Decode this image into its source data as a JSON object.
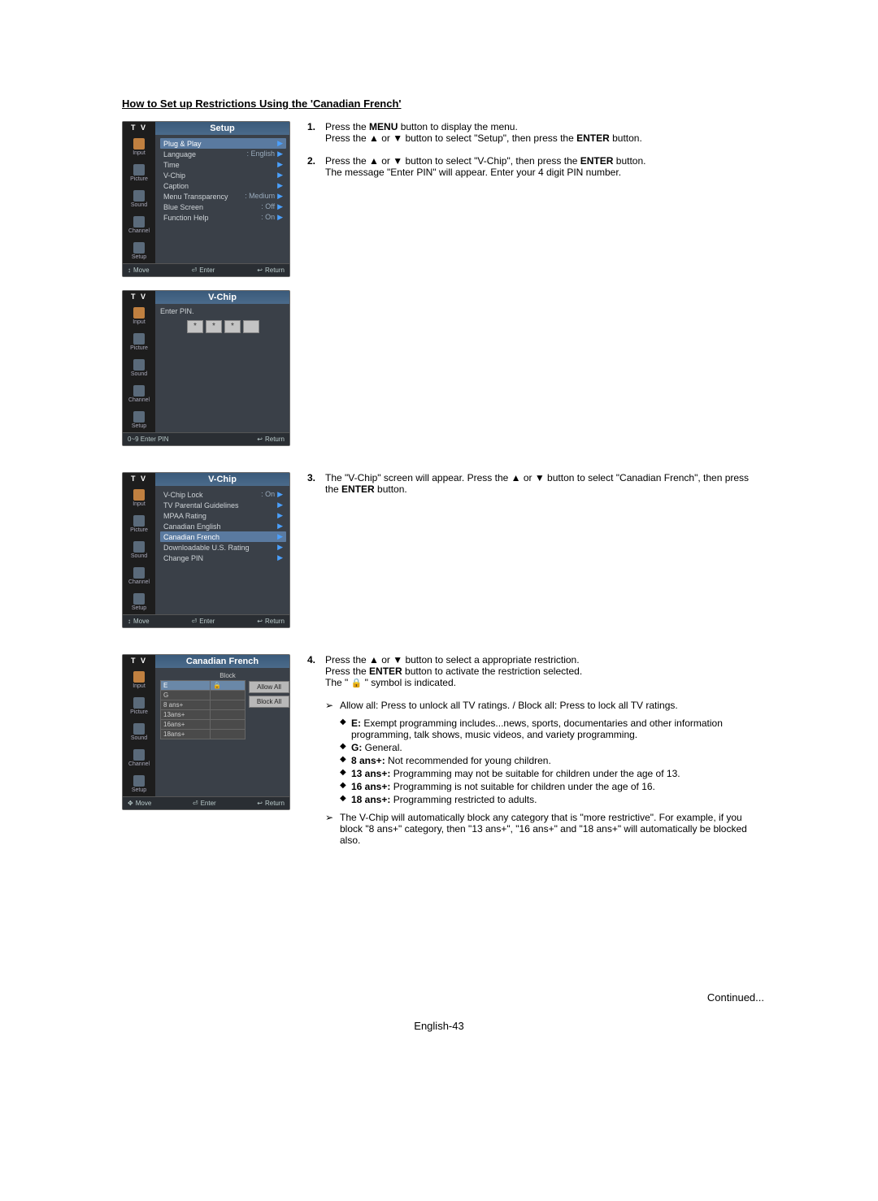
{
  "title": "How to Set up Restrictions Using the 'Canadian French'",
  "sidebar_labels": [
    "Input",
    "Picture",
    "Sound",
    "Channel",
    "Setup"
  ],
  "tv_label": "T V",
  "menu1": {
    "title": "Setup",
    "items": [
      {
        "label": "Plug & Play",
        "val": "",
        "sel": true
      },
      {
        "label": "Language",
        "val": ": English"
      },
      {
        "label": "Time",
        "val": ""
      },
      {
        "label": "V-Chip",
        "val": ""
      },
      {
        "label": "Caption",
        "val": ""
      },
      {
        "label": "Menu Transparency",
        "val": ": Medium"
      },
      {
        "label": "Blue Screen",
        "val": ": Off"
      },
      {
        "label": "Function Help",
        "val": ": On"
      }
    ],
    "footer": {
      "a": "Move",
      "b": "Enter",
      "c": "Return"
    },
    "footer_icon_a": "↕"
  },
  "menu2": {
    "title": "V-Chip",
    "prompt": "Enter PIN.",
    "stars": [
      "*",
      "*",
      "*",
      ""
    ],
    "footer": {
      "a": "0~9  Enter PIN",
      "c": "Return"
    }
  },
  "menu3": {
    "title": "V-Chip",
    "items": [
      {
        "label": "V-Chip Lock",
        "val": ": On"
      },
      {
        "label": "TV Parental Guidelines",
        "val": ""
      },
      {
        "label": "MPAA Rating",
        "val": ""
      },
      {
        "label": "Canadian English",
        "val": ""
      },
      {
        "label": "Canadian French",
        "val": "",
        "sel": true
      },
      {
        "label": "Downloadable U.S. Rating",
        "val": ""
      },
      {
        "label": "Change PIN",
        "val": ""
      }
    ],
    "footer": {
      "a": "Move",
      "b": "Enter",
      "c": "Return"
    },
    "footer_icon_a": "↕"
  },
  "menu4": {
    "title": "Canadian French",
    "col": "Block",
    "rows": [
      {
        "r": "E",
        "sel": true,
        "lock": true
      },
      {
        "r": "G"
      },
      {
        "r": "8  ans+"
      },
      {
        "r": "13ans+"
      },
      {
        "r": "16ans+"
      },
      {
        "r": "18ans+"
      }
    ],
    "btn_allow": "Allow All",
    "btn_block": "Block All",
    "footer": {
      "a": "Move",
      "b": "Enter",
      "c": "Return"
    },
    "footer_icon_a": "✥"
  },
  "steps": {
    "s1a": "Press the ",
    "s1b": "MENU",
    "s1c": " button to display the menu.",
    "s1d": "Press the ▲ or ▼ button to select \"Setup\", then press the ",
    "s1e": "ENTER",
    "s1f": " button.",
    "s2a": "Press the ▲ or ▼ button to select \"V-Chip\", then press the ",
    "s2b": "ENTER",
    "s2c": " button.",
    "s2d": "The message \"Enter PIN\" will appear. Enter your 4 digit PIN number.",
    "s3a": "The \"V-Chip\" screen will appear. Press the ▲ or ▼ button to select \"Canadian French\", then press the ",
    "s3b": "ENTER",
    "s3c": " button.",
    "s4a": "Press the ▲ or ▼ button to select a appropriate restriction.",
    "s4b": "Press the ",
    "s4c": "ENTER",
    "s4d": " button to activate the restriction selected.",
    "s4e": "The \" ",
    "s4f": " \" symbol is indicated."
  },
  "note1": "Allow all: Press to unlock all TV ratings. / Block all: Press to lock all TV ratings.",
  "defs": [
    {
      "k": "E:",
      "t": " Exempt programming includes...news, sports, documentaries and other information programming, talk shows, music videos, and variety programming."
    },
    {
      "k": "G:",
      "t": " General."
    },
    {
      "k": "8 ans+:",
      "t": " Not recommended for young children."
    },
    {
      "k": "13 ans+:",
      "t": " Programming may not be suitable for children under the age of 13."
    },
    {
      "k": "16 ans+:",
      "t": " Programming is not suitable for children under the age of 16."
    },
    {
      "k": "18 ans+:",
      "t": " Programming restricted to adults."
    }
  ],
  "note2": "The V-Chip will automatically block any category that is \"more restrictive\". For example, if you block \"8 ans+\" category, then \"13 ans+\", \"16 ans+\" and \"18 ans+\" will automatically be blocked also.",
  "continued": "Continued...",
  "pagefoot": "English-43"
}
